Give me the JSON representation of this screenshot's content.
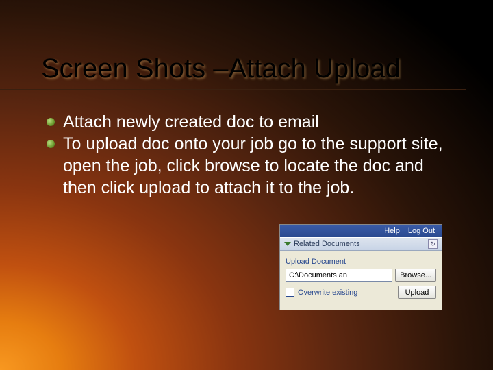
{
  "slide": {
    "title": "Screen Shots –Attach Upload",
    "bullets": [
      "Attach newly created doc to email",
      "To upload doc onto your job go to the support site, open the job, click browse to locate the doc and then click upload to attach it to the job."
    ]
  },
  "screenshot": {
    "topbar": {
      "help": "Help",
      "logout": "Log Out"
    },
    "section_label": "Related Documents",
    "upload_label": "Upload Document",
    "path_value": "C:\\Documents an",
    "browse_label": "Browse...",
    "overwrite_label": "Overwrite existing",
    "upload_button": "Upload",
    "refresh_glyph": "↻"
  }
}
